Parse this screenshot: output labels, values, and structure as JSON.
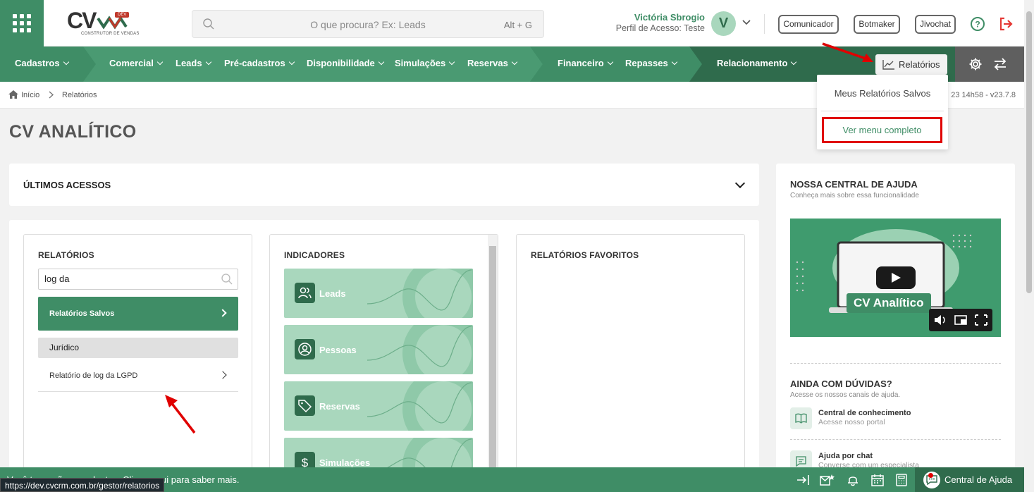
{
  "header": {
    "logo_text": "CV",
    "logo_badge": "DEV",
    "logo_sub": "CONSTRUTOR DE VENDAS",
    "search_placeholder": "O que procura? Ex: Leads",
    "search_shortcut": "Alt + G",
    "user_name": "Victória Sbrogio",
    "user_role": "Perfil de Acesso: Teste",
    "avatar_letter": "V",
    "buttons": [
      "Comunicador",
      "Botmaker",
      "Jivochat"
    ]
  },
  "nav": {
    "items": [
      "Cadastros",
      "Comercial",
      "Leads",
      "Pré-cadastros",
      "Disponibilidade",
      "Simulações",
      "Reservas",
      "Financeiro",
      "Repasses",
      "Relacionamento"
    ],
    "relatorios_label": "Relatórios"
  },
  "dropdown": {
    "item1": "Meus Relatórios Salvos",
    "item2": "Ver menu completo"
  },
  "breadcrumb": {
    "home": "Início",
    "current": "Relatórios",
    "version": "23 14h58 - v23.7.8"
  },
  "page": {
    "title": "CV ANALÍTICO",
    "ultimos_acessos": "ÚLTIMOS ACESSOS"
  },
  "relatorios": {
    "heading": "RELATÓRIOS",
    "search_value": "log da",
    "saved_label": "Relatórios Salvos",
    "category": "Jurídico",
    "item": "Relatório de log da LGPD"
  },
  "indicadores": {
    "heading": "INDICADORES",
    "items": [
      "Leads",
      "Pessoas",
      "Reservas",
      "Simulações"
    ]
  },
  "favoritos": {
    "heading": "RELATÓRIOS FAVORITOS"
  },
  "ajuda": {
    "heading": "NOSSA CENTRAL DE AJUDA",
    "subheading": "Conheça mais sobre essa funcionalidade",
    "video_title": "CV Analítico",
    "duvidas_heading": "AINDA COM DÚVIDAS?",
    "duvidas_sub": "Acesse os nossos canais de ajuda.",
    "channels": [
      {
        "title": "Central de conhecimento",
        "sub": "Acesse nosso portal"
      },
      {
        "title": "Ajuda por chat",
        "sub": "Converse com um especialista"
      }
    ]
  },
  "bottombar": {
    "message": "Você tem ações pendentes. Clique aqui para saber mais.",
    "help_label": "Central de Ajuda",
    "url_tooltip": "https://dev.cvcrm.com.br/gestor/relatorios"
  },
  "colors": {
    "brand_green": "#3f8d66",
    "dark_green": "#2f6b4c",
    "light_green": "#a9d7bd",
    "highlight_red": "#e00000"
  }
}
